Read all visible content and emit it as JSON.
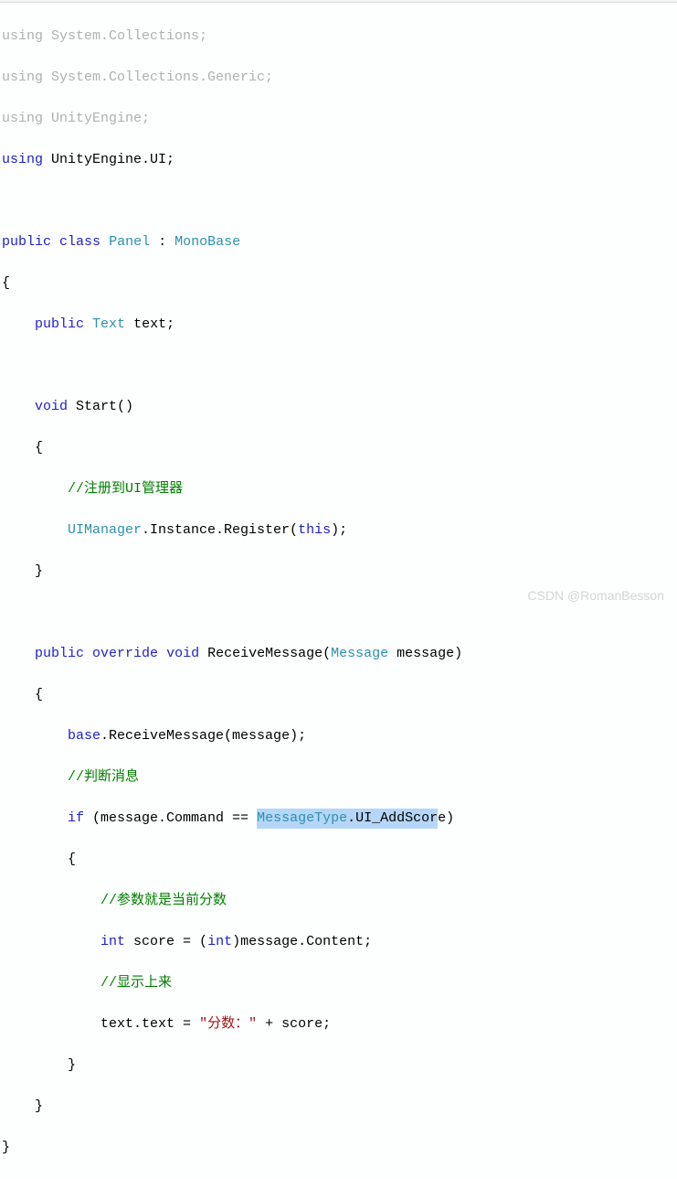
{
  "code": {
    "l01": {
      "a": "using",
      "b": " System.Collections;"
    },
    "l02": {
      "a": "using",
      "b": " System.Collections.Generic;"
    },
    "l03": {
      "a": "using",
      "b": " UnityEngine;"
    },
    "l04": {
      "a": "using",
      "b": " UnityEngine.UI;"
    },
    "l06": {
      "a": "public",
      "b": "class",
      "c": "Panel",
      "d": " : ",
      "e": "MonoBase"
    },
    "l08": {
      "a": "public",
      "b": "Text",
      "c": " text;"
    },
    "l10": {
      "a": "void",
      "b": " Start()"
    },
    "l12": {
      "a": "//注册到UI管理器"
    },
    "l13": {
      "a": "UIManager",
      "b": ".Instance.Register(",
      "c": "this",
      "d": ");"
    },
    "l16": {
      "a": "public",
      "b": "override",
      "c": "void",
      "d": " ReceiveMessage(",
      "e": "Message",
      "f": " message)"
    },
    "l18": {
      "a": "base",
      "b": ".ReceiveMessage(message);"
    },
    "l19": {
      "a": "//判断消息"
    },
    "l20": {
      "a": "if",
      "b": " (message.Command == ",
      "c": "MessageType",
      "d": ".UI_AddScor",
      "e": "e)"
    },
    "l22": {
      "a": "//参数就是当前分数"
    },
    "l23": {
      "a": "int",
      "b": " score = (",
      "c": "int",
      "d": ")message.Content;"
    },
    "l24": {
      "a": "//显示上来"
    },
    "l25": {
      "a": "text.text = ",
      "b": "\"分数：\"",
      "c": " + score;"
    }
  },
  "braces": {
    "open": "{",
    "close": "}"
  },
  "watermark": "CSDN @RomanBesson"
}
